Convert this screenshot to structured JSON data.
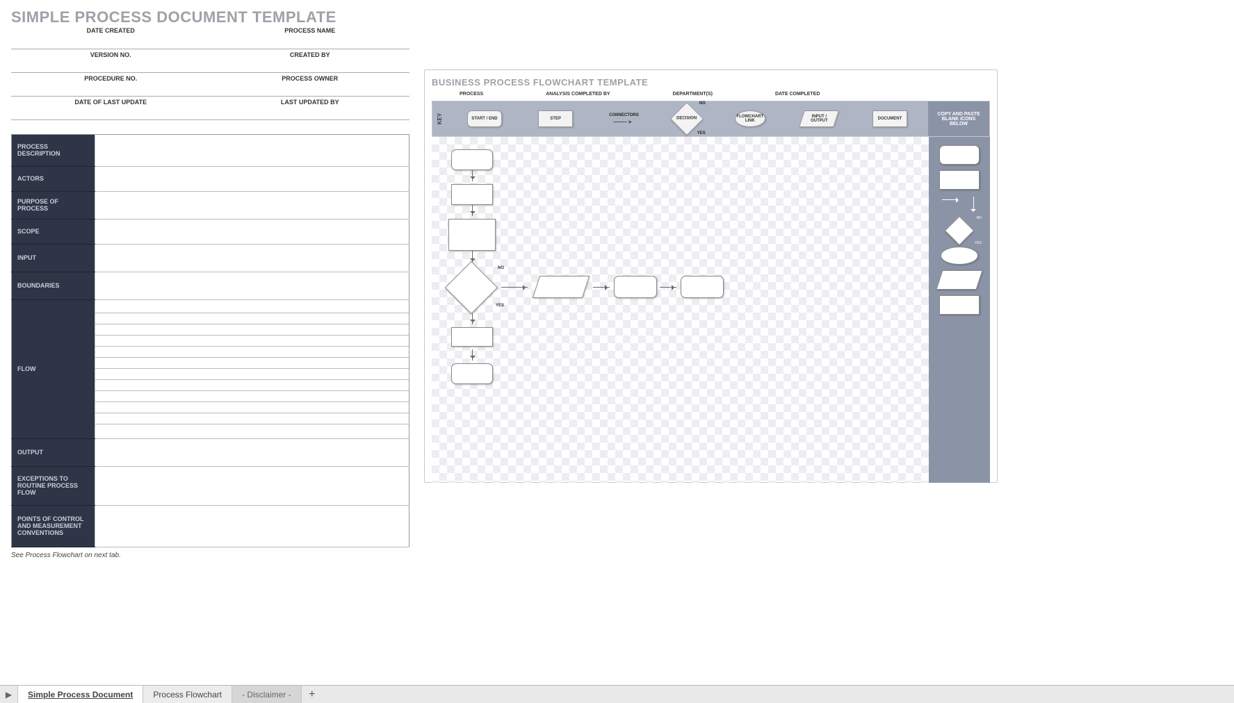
{
  "page_title": "SIMPLE PROCESS DOCUMENT TEMPLATE",
  "meta_labels": {
    "date_created": "DATE CREATED",
    "process_name": "PROCESS NAME",
    "version_no": "VERSION NO.",
    "created_by": "CREATED BY",
    "procedure_no": "PROCEDURE NO.",
    "process_owner": "PROCESS OWNER",
    "date_last_update": "DATE OF LAST UPDATE",
    "last_updated_by": "LAST UPDATED BY"
  },
  "body_labels": {
    "process_description": "PROCESS\nDESCRIPTION",
    "actors": "ACTORS",
    "purpose": "PURPOSE\nOF PROCESS",
    "scope": "SCOPE",
    "input": "INPUT",
    "boundaries": "BOUNDARIES",
    "flow": "FLOW",
    "output": "OUTPUT",
    "exceptions": "EXCEPTIONS TO\nROUTINE PROCESS FLOW",
    "points": "POINTS OF CONTROL\nAND MEASUREMENT\nCONVENTIONS"
  },
  "footnote": "See Process Flowchart on next tab.",
  "flow_title": "BUSINESS PROCESS FLOWCHART TEMPLATE",
  "flow_meta": {
    "process": "PROCESS",
    "analysis": "ANALYSIS COMPLETED BY",
    "dept": "DEPARTMENT(S)",
    "date": "DATE COMPLETED"
  },
  "key": {
    "label": "KEY",
    "start_end": "START / END",
    "step": "STEP",
    "connectors": "CONNECTORS",
    "decision": "DECISION",
    "no": "NO",
    "yes": "YES",
    "flowchart_link": "FLOWCHART\nLINK",
    "input_output": "INPUT /\nOUTPUT",
    "document": "DOCUMENT",
    "copy_paste": "COPY AND PASTE\nBLANK ICONS\nBELOW"
  },
  "tabs": {
    "t1": "Simple Process Document",
    "t2": "Process Flowchart",
    "t3": "- Disclaimer -"
  }
}
